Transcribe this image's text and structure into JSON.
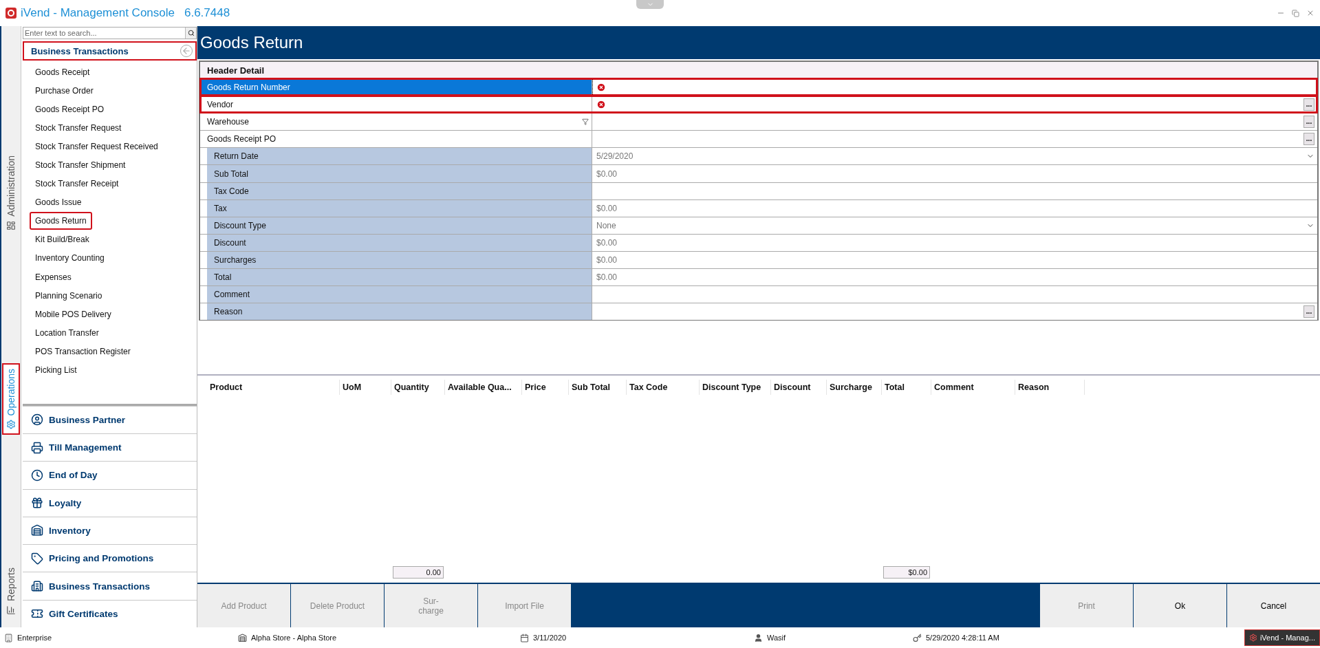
{
  "window": {
    "title": "iVend - Management Console",
    "version": "6.6.7448"
  },
  "side_tabs": [
    {
      "label": "Administration",
      "selected": false,
      "highlighted": false
    },
    {
      "label": "Operations",
      "selected": true,
      "highlighted": true
    },
    {
      "label": "Reports",
      "selected": false,
      "highlighted": false
    }
  ],
  "sidebar": {
    "search": {
      "placeholder": "Enter text to search..."
    },
    "group": {
      "title": "Business Transactions",
      "highlighted": true
    },
    "items": [
      {
        "label": "Goods Receipt",
        "highlighted": false
      },
      {
        "label": "Purchase Order",
        "highlighted": false
      },
      {
        "label": "Goods Receipt PO",
        "highlighted": false
      },
      {
        "label": "Stock Transfer Request",
        "highlighted": false
      },
      {
        "label": "Stock Transfer Request Received",
        "highlighted": false
      },
      {
        "label": "Stock Transfer Shipment",
        "highlighted": false
      },
      {
        "label": "Stock Transfer Receipt",
        "highlighted": false
      },
      {
        "label": "Goods Issue",
        "highlighted": false
      },
      {
        "label": "Goods Return",
        "highlighted": true
      },
      {
        "label": "Kit Build/Break",
        "highlighted": false
      },
      {
        "label": "Inventory Counting",
        "highlighted": false
      },
      {
        "label": "Expenses",
        "highlighted": false
      },
      {
        "label": "Planning Scenario",
        "highlighted": false
      },
      {
        "label": "Mobile POS Delivery",
        "highlighted": false
      },
      {
        "label": "Location Transfer",
        "highlighted": false
      },
      {
        "label": "POS Transaction Register",
        "highlighted": false
      },
      {
        "label": "Picking List",
        "highlighted": false
      }
    ],
    "sections": [
      "Business Partner",
      "Till Management",
      "End of Day",
      "Loyalty",
      "Inventory",
      "Pricing and Promotions",
      "Business Transactions",
      "Gift Certificates"
    ]
  },
  "page_title": "Goods Return",
  "header_detail": {
    "title": "Header Detail",
    "rows": [
      {
        "label": "Goods Return Number",
        "kind": "editable",
        "selected": true,
        "error": true,
        "highlighted": true
      },
      {
        "label": "Vendor",
        "kind": "editable",
        "selected": false,
        "error": true,
        "highlighted": true,
        "button": "..."
      },
      {
        "label": "Warehouse",
        "kind": "editable",
        "selected": false,
        "error": false,
        "highlighted": false,
        "filter": true,
        "button": "..."
      },
      {
        "label": "Goods Receipt PO",
        "kind": "editable",
        "selected": false,
        "error": false,
        "highlighted": false,
        "button": "..."
      },
      {
        "label": "Return Date",
        "kind": "readonly",
        "selected": false,
        "error": false,
        "highlighted": false,
        "value": "5/29/2020",
        "dropdown": true
      },
      {
        "label": "Sub Total",
        "kind": "readonly",
        "selected": false,
        "error": false,
        "highlighted": false,
        "value": "$0.00"
      },
      {
        "label": "Tax Code",
        "kind": "readonly",
        "selected": false,
        "error": false,
        "highlighted": false
      },
      {
        "label": "Tax",
        "kind": "readonly",
        "selected": false,
        "error": false,
        "highlighted": false,
        "value": "$0.00"
      },
      {
        "label": "Discount Type",
        "kind": "readonly",
        "selected": false,
        "error": false,
        "highlighted": false,
        "value": "None",
        "dropdown": true
      },
      {
        "label": "Discount",
        "kind": "readonly",
        "selected": false,
        "error": false,
        "highlighted": false,
        "value": "$0.00"
      },
      {
        "label": "Surcharges",
        "kind": "readonly",
        "selected": false,
        "error": false,
        "highlighted": false,
        "value": "$0.00"
      },
      {
        "label": "Total",
        "kind": "readonly",
        "selected": false,
        "error": false,
        "highlighted": false,
        "value": "$0.00"
      },
      {
        "label": "Comment",
        "kind": "readonly",
        "selected": false,
        "error": false,
        "highlighted": false
      },
      {
        "label": "Reason",
        "kind": "readonly",
        "selected": false,
        "error": false,
        "highlighted": false,
        "button": "..."
      }
    ]
  },
  "lines_table": {
    "columns": [
      {
        "label": "Product"
      },
      {
        "label": "UoM"
      },
      {
        "label": "Quantity",
        "footer": "0.00"
      },
      {
        "label": "Available Qua..."
      },
      {
        "label": "Price"
      },
      {
        "label": "Sub Total"
      },
      {
        "label": "Tax Code"
      },
      {
        "label": "Discount Type"
      },
      {
        "label": "Discount"
      },
      {
        "label": "Surcharge"
      },
      {
        "label": "Total",
        "footer": "$0.00"
      },
      {
        "label": "Comment"
      },
      {
        "label": "Reason"
      }
    ]
  },
  "left_buttons": [
    {
      "label": "Add  Product",
      "disabled": true
    },
    {
      "label": "Delete Product",
      "disabled": true
    },
    {
      "label": "Sur-\ncharge",
      "disabled": true
    },
    {
      "label": "Import File",
      "disabled": true
    }
  ],
  "right_buttons": [
    {
      "label": "Print",
      "disabled": true
    },
    {
      "label": "Ok",
      "disabled": false
    },
    {
      "label": "Cancel",
      "disabled": false
    }
  ],
  "status_bar": {
    "company": "Enterprise",
    "store": "Alpha Store - Alpha Store",
    "date": "3/11/2020",
    "user": "Wasif",
    "login_time": "5/29/2020 4:28:11 AM",
    "taskbar_item": "iVend - Manag..."
  }
}
